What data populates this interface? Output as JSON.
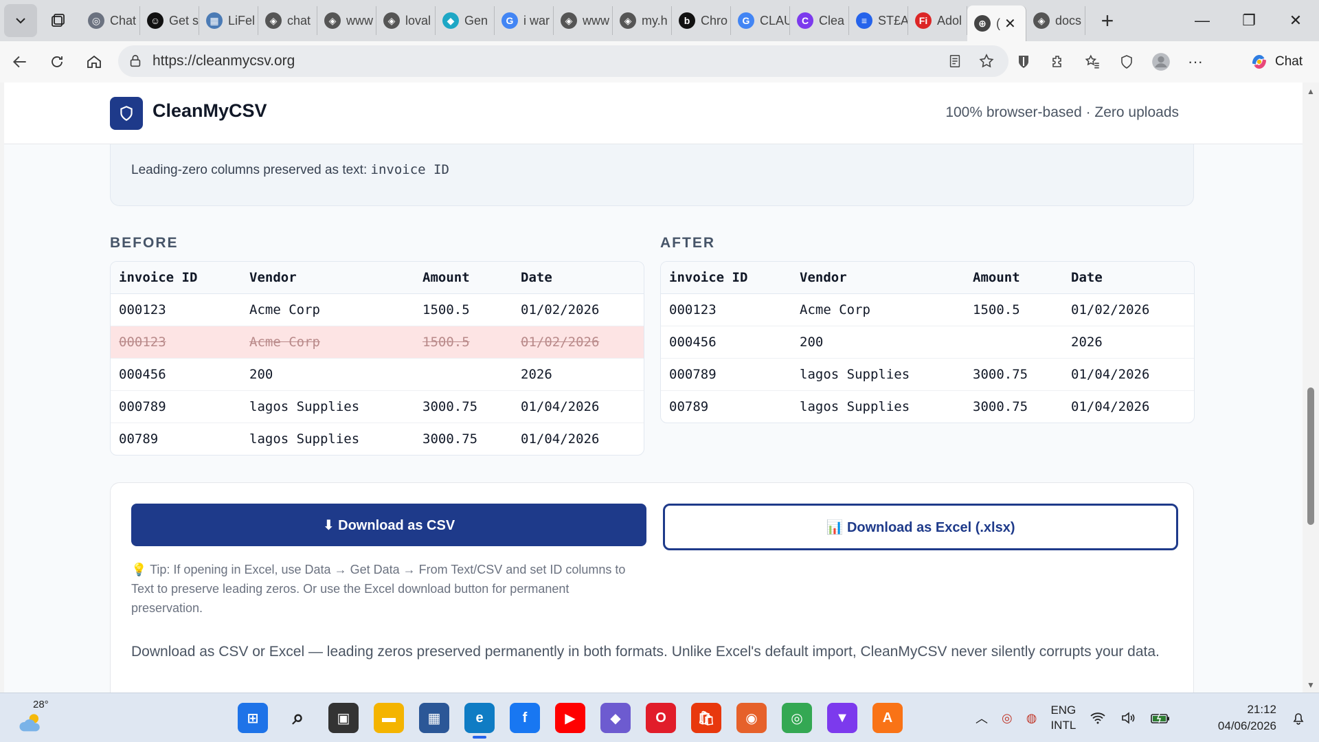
{
  "browser": {
    "tabs": [
      {
        "label": "Chat",
        "favicon_color": "#6b7280",
        "glyph": "◎"
      },
      {
        "label": "Get s",
        "favicon_color": "#111111",
        "glyph": "☺"
      },
      {
        "label": "LiFel",
        "favicon_color": "#4b7bb5",
        "glyph": "▦"
      },
      {
        "label": "chat",
        "favicon_color": "#555555",
        "glyph": "◈"
      },
      {
        "label": "www",
        "favicon_color": "#555555",
        "glyph": "◈"
      },
      {
        "label": "loval",
        "favicon_color": "#555555",
        "glyph": "◈"
      },
      {
        "label": "Gen",
        "favicon_color": "#1ea7c5",
        "glyph": "◆"
      },
      {
        "label": "i war",
        "favicon_color": "#4285f4",
        "glyph": "G"
      },
      {
        "label": "www",
        "favicon_color": "#555555",
        "glyph": "◈"
      },
      {
        "label": "my.h",
        "favicon_color": "#555555",
        "glyph": "◈"
      },
      {
        "label": "Chro",
        "favicon_color": "#111111",
        "glyph": "b"
      },
      {
        "label": "CLAU",
        "favicon_color": "#4285f4",
        "glyph": "G"
      },
      {
        "label": "Clea",
        "favicon_color": "#7c3aed",
        "glyph": "C"
      },
      {
        "label": "ST£A",
        "favicon_color": "#2563eb",
        "glyph": "≡"
      },
      {
        "label": "Adol",
        "favicon_color": "#dc2626",
        "glyph": "Fi"
      },
      {
        "label": "(",
        "favicon_color": "#444444",
        "glyph": "⊕",
        "active": true
      },
      {
        "label": "docs",
        "favicon_color": "#555555",
        "glyph": "◈"
      }
    ],
    "url": "https://cleanmycsv.org",
    "copilot_label": "Chat"
  },
  "site": {
    "brand": "CleanMyCSV",
    "tagline": "100% browser-based · Zero uploads",
    "info_prefix": "Leading-zero columns preserved as text: ",
    "info_cols": "invoice ID"
  },
  "before": {
    "title": "BEFORE",
    "headers": [
      "invoice ID",
      "Vendor",
      "Amount",
      "Date"
    ],
    "rows": [
      {
        "cells": [
          "000123",
          "Acme Corp",
          "1500.5",
          "01/02/2026"
        ],
        "duplicate": false
      },
      {
        "cells": [
          "000123",
          "Acme Corp",
          "1500.5",
          "01/02/2026"
        ],
        "duplicate": true
      },
      {
        "cells": [
          "000456",
          "200",
          "",
          "2026"
        ],
        "duplicate": false
      },
      {
        "cells": [
          "000789",
          "lagos Supplies",
          "3000.75",
          "01/04/2026"
        ],
        "duplicate": false
      },
      {
        "cells": [
          "00789",
          "lagos Supplies",
          "3000.75",
          "01/04/2026"
        ],
        "duplicate": false
      }
    ]
  },
  "after": {
    "title": "AFTER",
    "headers": [
      "invoice ID",
      "Vendor",
      "Amount",
      "Date"
    ],
    "rows": [
      {
        "cells": [
          "000123",
          "Acme Corp",
          "1500.5",
          "01/02/2026"
        ],
        "duplicate": false
      },
      {
        "cells": [
          "000456",
          "200",
          "",
          "2026"
        ],
        "duplicate": false
      },
      {
        "cells": [
          "000789",
          "lagos Supplies",
          "3000.75",
          "01/04/2026"
        ],
        "duplicate": false
      },
      {
        "cells": [
          "00789",
          "lagos Supplies",
          "3000.75",
          "01/04/2026"
        ],
        "duplicate": false
      }
    ]
  },
  "download": {
    "csv_label": "⬇ Download as CSV",
    "xlsx_label": "📊 Download as Excel (.xlsx)",
    "tip": "💡 Tip: If opening in Excel, use Data → Get Data → From Text/CSV and set ID columns to Text to preserve leading zeros. Or use the Excel download button for permanent preservation.",
    "description": "Download as CSV or Excel — leading zeros preserved permanently in both formats. Unlike Excel's default import, CleanMyCSV never silently corrupts your data."
  },
  "colors": {
    "brand_blue": "#1e3a8a",
    "duplicate_row": "#fde4e4"
  },
  "taskbar": {
    "weather_temp": "28°",
    "lang_top": "ENG",
    "lang_bottom": "INTL",
    "time": "21:12",
    "date": "04/06/2026",
    "apps": [
      {
        "name": "start",
        "color": "#1e73e8",
        "glyph": "⊞"
      },
      {
        "name": "search",
        "color": "transparent",
        "glyph": "⌕"
      },
      {
        "name": "task-view",
        "color": "#333333",
        "glyph": "▣"
      },
      {
        "name": "file-explorer",
        "color": "#f4b400",
        "glyph": "▬"
      },
      {
        "name": "store",
        "color": "#2b5797",
        "glyph": "▦"
      },
      {
        "name": "edge",
        "color": "#0f7cc4",
        "glyph": "e",
        "on": true
      },
      {
        "name": "facebook",
        "color": "#1877f2",
        "glyph": "f"
      },
      {
        "name": "youtube",
        "color": "#ff0000",
        "glyph": "▶"
      },
      {
        "name": "copilot",
        "color": "#6d5bd0",
        "glyph": "◆"
      },
      {
        "name": "opera",
        "color": "#e11d2a",
        "glyph": "O"
      },
      {
        "name": "shopping",
        "color": "#e8380d",
        "glyph": "🛍"
      },
      {
        "name": "firefox",
        "color": "#e6612a",
        "glyph": "◉"
      },
      {
        "name": "chrome",
        "color": "#34a853",
        "glyph": "◎"
      },
      {
        "name": "vpn",
        "color": "#7c3aed",
        "glyph": "▼"
      },
      {
        "name": "avast",
        "color": "#f97316",
        "glyph": "A"
      }
    ]
  }
}
